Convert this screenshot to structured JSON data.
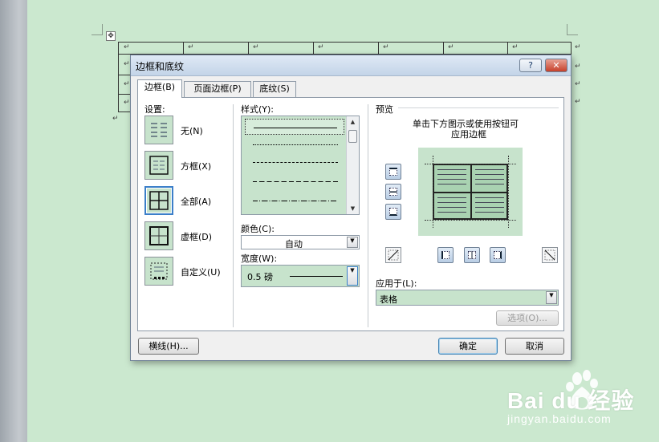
{
  "dialog": {
    "title": "边框和底纹",
    "help_label": "?",
    "close_label": "✕"
  },
  "tabs": [
    {
      "label": "边框(B)",
      "active": true
    },
    {
      "label": "页面边框(P)",
      "active": false
    },
    {
      "label": "底纹(S)",
      "active": false
    }
  ],
  "settings": {
    "heading": "设置:",
    "items": [
      {
        "label": "无(N)",
        "icon": "none-border-icon"
      },
      {
        "label": "方框(X)",
        "icon": "box-border-icon"
      },
      {
        "label": "全部(A)",
        "icon": "all-borders-icon",
        "selected": true
      },
      {
        "label": "虚框(D)",
        "icon": "grid-border-icon"
      },
      {
        "label": "自定义(U)",
        "icon": "custom-border-icon"
      }
    ]
  },
  "style": {
    "heading": "样式(Y):",
    "line_styles": [
      "solid",
      "dotted",
      "dashed-small",
      "dashed",
      "dash-dot"
    ]
  },
  "color": {
    "label": "颜色(C):",
    "value": "自动"
  },
  "width": {
    "label": "宽度(W):",
    "value": "0.5 磅"
  },
  "preview": {
    "heading": "预览",
    "hint_line1": "单击下方图示或使用按钮可",
    "hint_line2": "应用边框"
  },
  "apply_to": {
    "label": "应用于(L):",
    "value": "表格"
  },
  "buttons": {
    "options": "选项(O)...",
    "horizontal_line": "横线(H)...",
    "ok": "确定",
    "cancel": "取消"
  },
  "watermark": {
    "brand": "Bai du 经验",
    "url": "jingyan.baidu.com"
  },
  "colors": {
    "page_bg": "#cbe8cf",
    "accent": "#3b7fc9",
    "close_red": "#c6402a"
  }
}
